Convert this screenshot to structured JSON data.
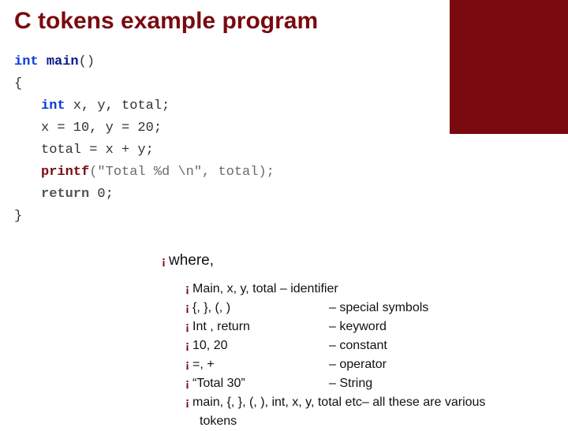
{
  "title": "C tokens example program",
  "code": {
    "l1a": "int",
    "l1b": "main",
    "l1c": "()",
    "l2": "{",
    "l3a": "int",
    "l3b": " x, y, total;",
    "l4": "x = 10, y = 20;",
    "l5": "total = x + y;",
    "l6a": "printf",
    "l6b": "(\"Total %d \\n\", total);",
    "l7a": "return",
    "l7b": " 0;",
    "l8": "}"
  },
  "where_label": "where,",
  "bullets": {
    "b1": "Main, x, y, total – identifier",
    "b2l": "{, }, (, )",
    "b2r": "– special symbols",
    "b3l": "Int , return",
    "b3r": "– keyword",
    "b4l": "10, 20",
    "b4r": "– constant",
    "b5l": "=, +",
    "b5r": "– operator",
    "b6l": "“Total 30”",
    "b6r": "– String",
    "b7": "main, {, }, (, ), int, x, y, total  etc– all these are various",
    "b7b": "tokens"
  }
}
